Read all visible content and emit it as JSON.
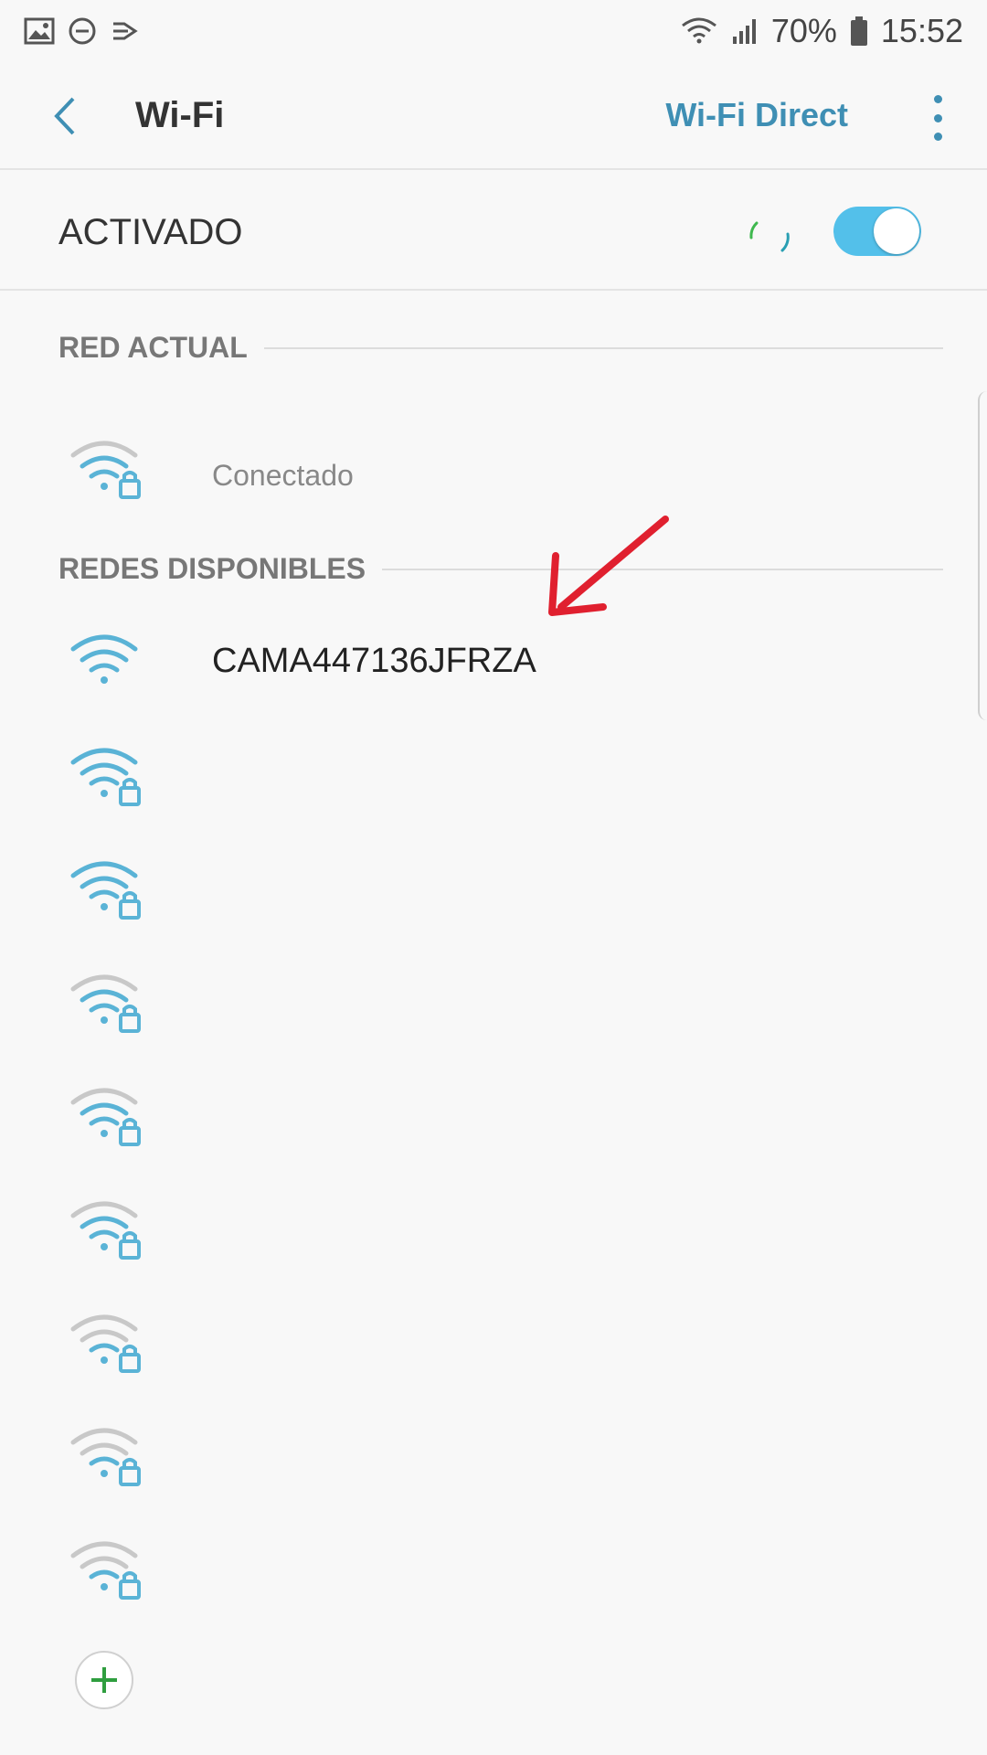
{
  "status_bar": {
    "battery": "70%",
    "time": "15:52",
    "left_icons": [
      "image-icon",
      "do-not-disturb-icon",
      "cast-icon"
    ],
    "right_icons": [
      "wifi-signal-icon",
      "cellular-signal-icon",
      "battery-icon"
    ]
  },
  "app_bar": {
    "title": "Wi-Fi",
    "wifi_direct": "Wi-Fi Direct"
  },
  "toggle": {
    "label": "ACTIVADO",
    "state": "on"
  },
  "current_network": {
    "header": "RED ACTUAL",
    "name": "",
    "status": "Conectado"
  },
  "available": {
    "header": "REDES DISPONIBLES",
    "networks": [
      {
        "name": "CAMA447136JFRZA",
        "locked": false,
        "strength": 3
      },
      {
        "name": "",
        "locked": true,
        "strength": 3
      },
      {
        "name": "",
        "locked": true,
        "strength": 3
      },
      {
        "name": "",
        "locked": true,
        "strength": 2
      },
      {
        "name": "",
        "locked": true,
        "strength": 2
      },
      {
        "name": "",
        "locked": true,
        "strength": 2
      },
      {
        "name": "",
        "locked": true,
        "strength": 1
      },
      {
        "name": "",
        "locked": true,
        "strength": 1
      },
      {
        "name": "",
        "locked": true,
        "strength": 1
      }
    ]
  },
  "colors": {
    "accent": "#3f8fb4",
    "switch_on": "#53c0ea",
    "wifi_active": "#5ab3d6",
    "wifi_inactive": "#c8c8c8",
    "annotation_arrow": "#e0202f",
    "add_icon": "#2f9e3f"
  }
}
